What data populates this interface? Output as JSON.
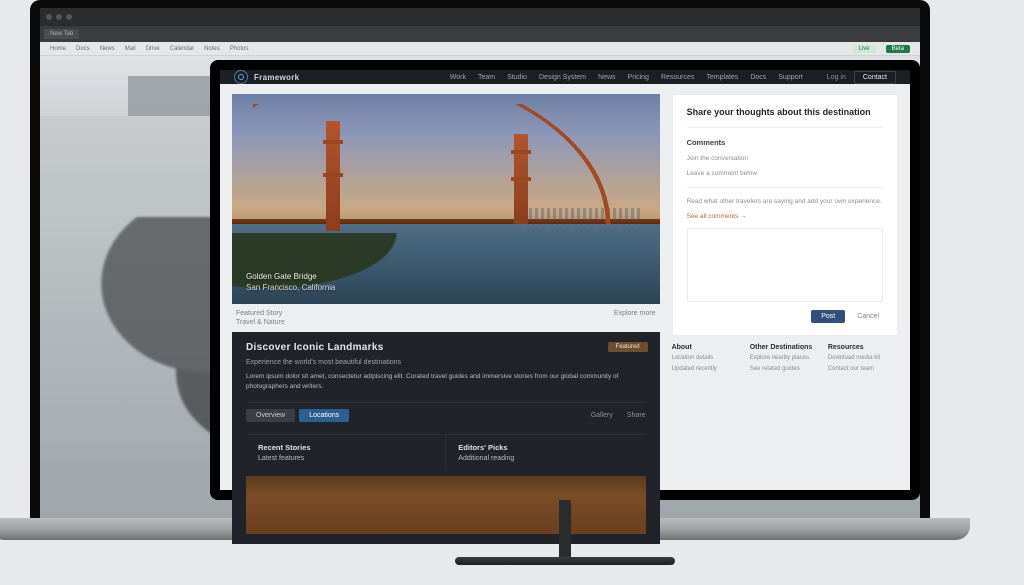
{
  "browser": {
    "tabs": [
      "New Tab"
    ],
    "bookmarks": [
      "Home",
      "Docs",
      "News",
      "Mail",
      "Drive",
      "Calendar",
      "Notes",
      "Photos"
    ],
    "pill1": "Live",
    "pill2": "Beta"
  },
  "site": {
    "brand": "Framework",
    "nav": [
      "Work",
      "Team",
      "Studio",
      "Design System",
      "News",
      "Pricing",
      "Resources",
      "Templates",
      "Docs",
      "Support"
    ],
    "login": "Log in",
    "cta": "Contact"
  },
  "hero": {
    "line1": "Golden Gate Bridge",
    "line2": "San Francisco, California"
  },
  "darkCard": {
    "title": "Discover Iconic Landmarks",
    "subtitle": "Experience the world's most beautiful destinations",
    "chip": "Featured",
    "body": "Lorem ipsum dolor sit amet, consectetur adipiscing elit. Curated travel guides and immersive stories from our global community of photographers and writers.",
    "tabs": {
      "a": "Overview",
      "b": "Locations"
    },
    "right": {
      "a": "Gallery",
      "b": "Share"
    },
    "cellA": {
      "h": "Recent Stories",
      "t": "Latest features"
    },
    "cellB": {
      "h": "Editors' Picks",
      "t": "Additional reading"
    }
  },
  "leftMeta": {
    "a": "Featured Story",
    "b": "Travel & Nature",
    "c": "Explore more"
  },
  "panel": {
    "title": "Share your thoughts about this destination",
    "section": "Comments",
    "muted1": "Join the conversation",
    "muted2": "Leave a comment below",
    "body": "Read what other travelers are saying and add your own experience.",
    "link": "See all comments →",
    "btnPrimary": "Post",
    "btnGhost": "Cancel"
  },
  "info": {
    "h0": "About",
    "c0a": "Location details",
    "c0b": "Updated recently",
    "h1": "Other Destinations",
    "c1a": "Explore nearby places",
    "c1b": "See related guides",
    "h2": "Resources",
    "c2a": "Download media kit",
    "c2b": "Contact our team"
  }
}
